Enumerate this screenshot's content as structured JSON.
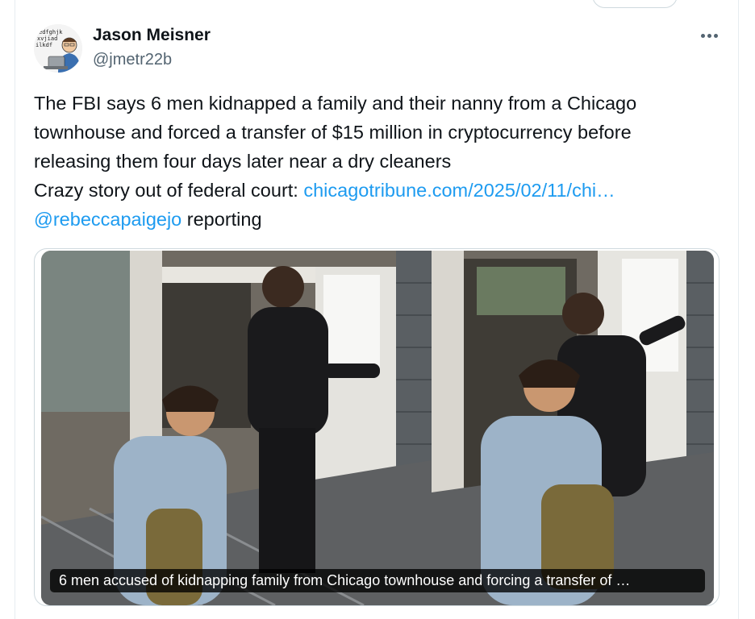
{
  "tweet": {
    "author": {
      "display_name": "Jason Meisner",
      "handle": "@jmetr22b",
      "avatar": "cartoon-avatar"
    },
    "more_icon": "more-horizontal-icon",
    "text": {
      "line1": "The FBI says 6 men kidnapped a family and their nanny from a Chicago",
      "line2": "townhouse and forced a transfer of $15 million in cryptocurrency before",
      "line3": "releasing them four days later near a dry cleaners",
      "line4_prefix": "Crazy story out of federal court: ",
      "link_url_text": "chicagotribune.com/2025/02/11/chi…",
      "mention": "@rebeccapaigejo",
      "line5_suffix": " reporting"
    },
    "media": {
      "caption": "6 men accused of kidnapping family from Chicago townhouse and forcing a transfer of …"
    }
  },
  "colors": {
    "link": "#1d9bf0",
    "text": "#0f1419",
    "secondary": "#536471",
    "border": "#cfd9de"
  }
}
